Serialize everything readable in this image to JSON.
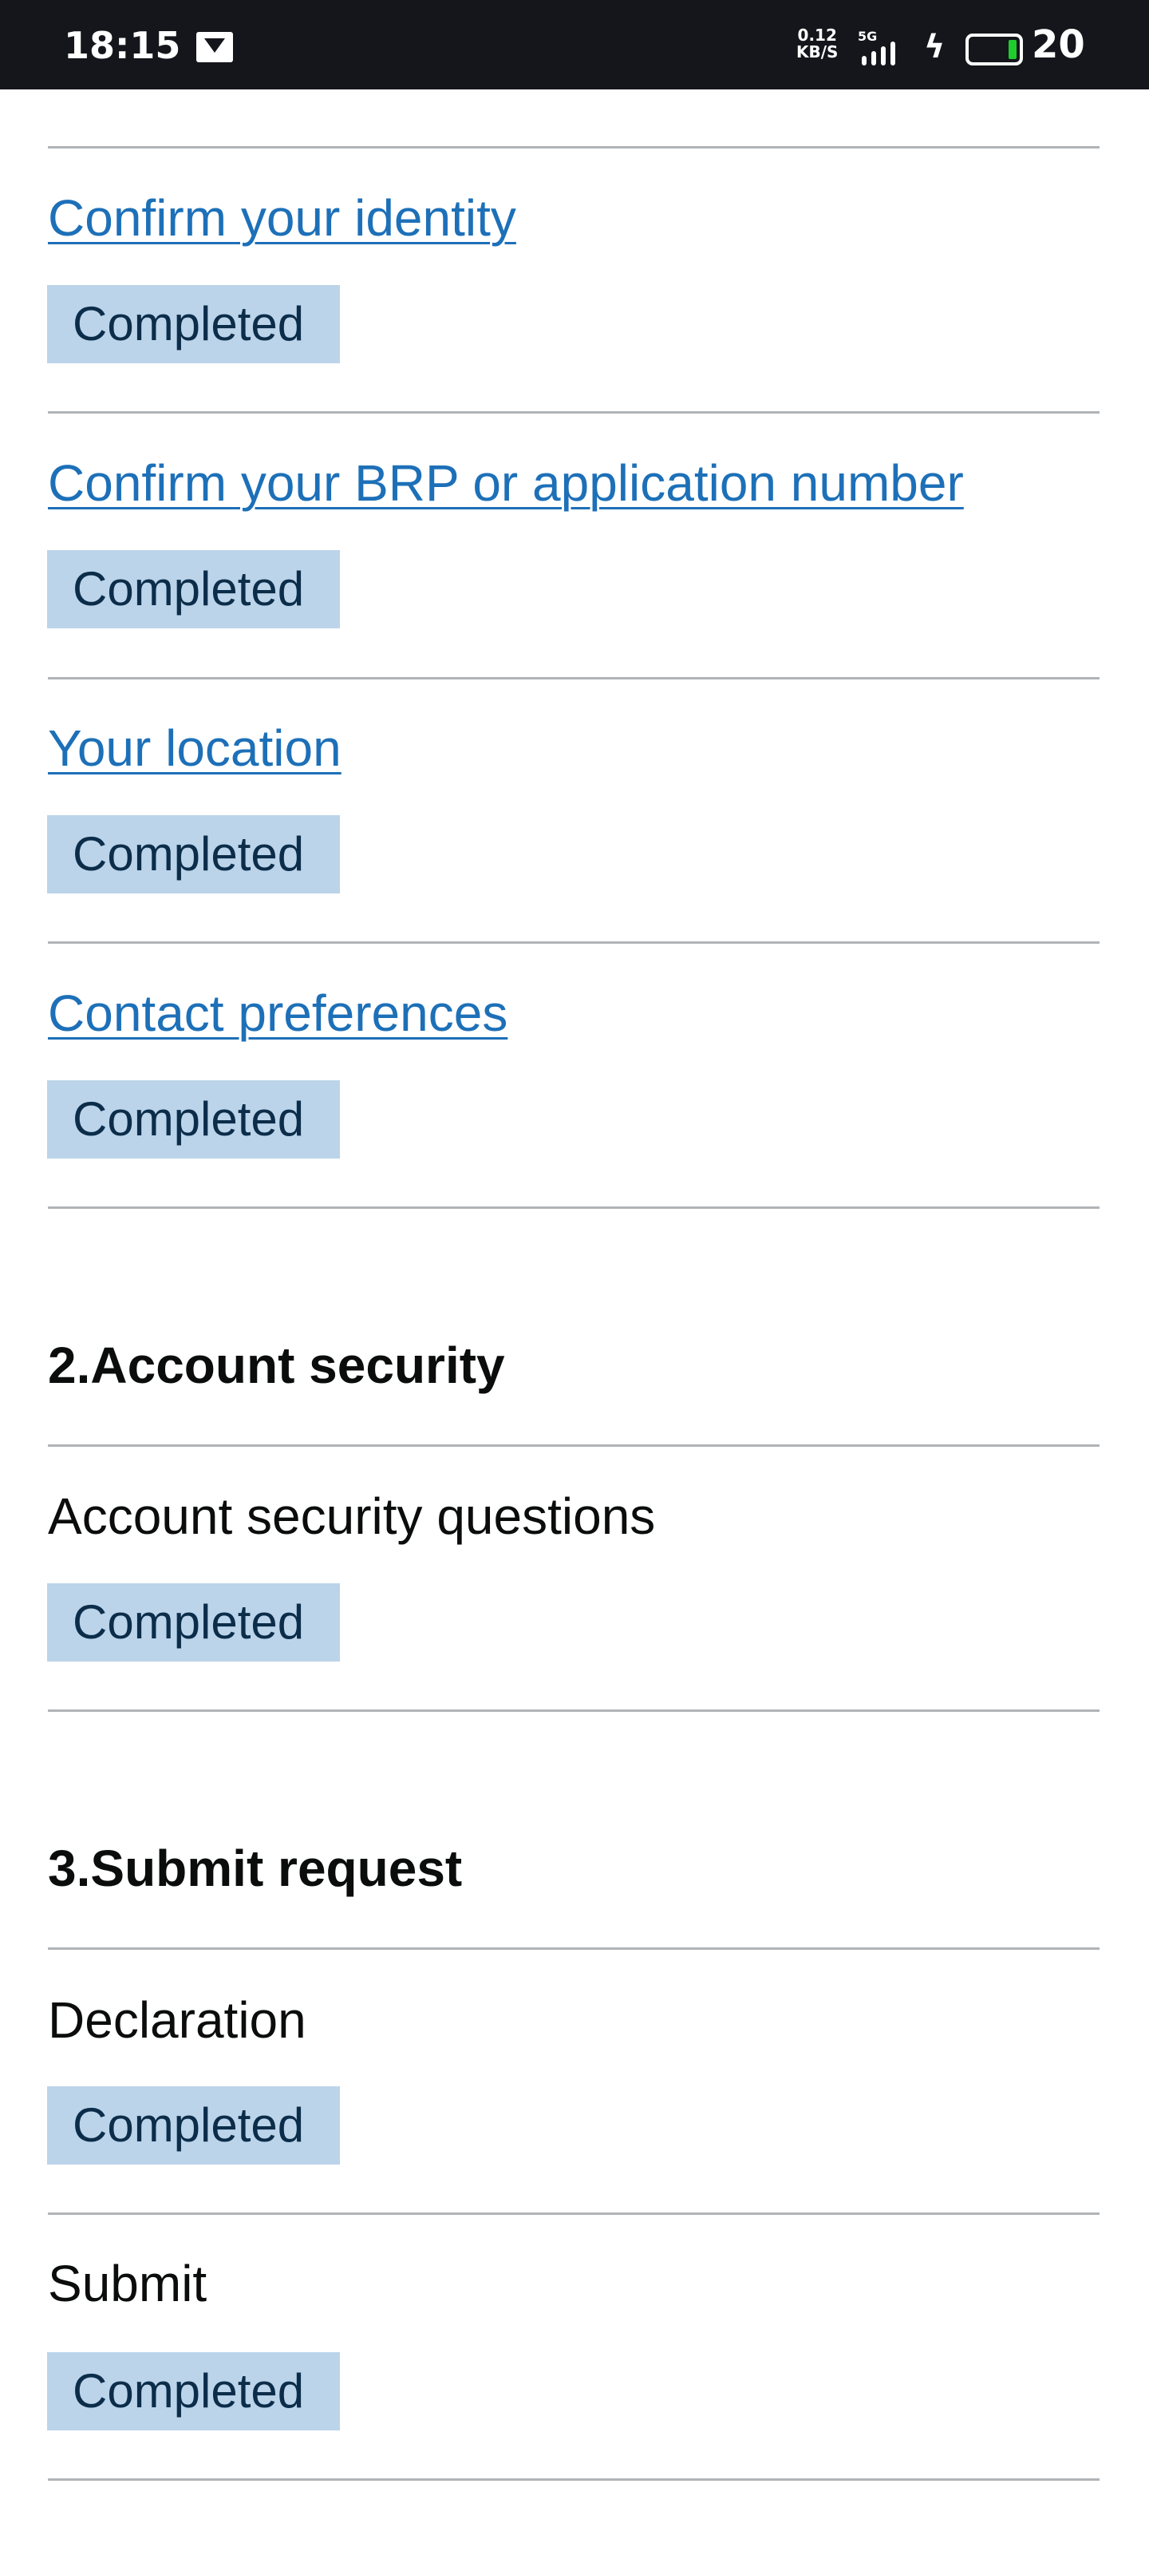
{
  "status_bar": {
    "time": "18:15",
    "net_speed_value": "0.12",
    "net_speed_unit": "KB/S",
    "network": "5G",
    "battery": "20",
    "battery_level": 0.2,
    "icons": [
      "gallery-notification-icon",
      "signal-icon",
      "charging-icon",
      "battery-icon"
    ]
  },
  "colors": {
    "link": "#1d70b8",
    "tag_bg": "#bbd4ea",
    "tag_text": "#0c2d4a",
    "divider": "#b1b4b6"
  },
  "section1": {
    "items": [
      {
        "label": "Confirm your identity",
        "status": "Completed"
      },
      {
        "label": "Confirm your BRP or application number",
        "status": "Completed"
      },
      {
        "label": "Your location",
        "status": "Completed"
      },
      {
        "label": "Contact preferences",
        "status": "Completed"
      }
    ]
  },
  "section2": {
    "heading": "2.Account security",
    "items": [
      {
        "label": "Account security questions",
        "status": "Completed"
      }
    ]
  },
  "section3": {
    "heading": "3.Submit request",
    "items": [
      {
        "label": "Declaration",
        "status": "Completed"
      },
      {
        "label": "Submit",
        "status": "Completed"
      }
    ]
  }
}
